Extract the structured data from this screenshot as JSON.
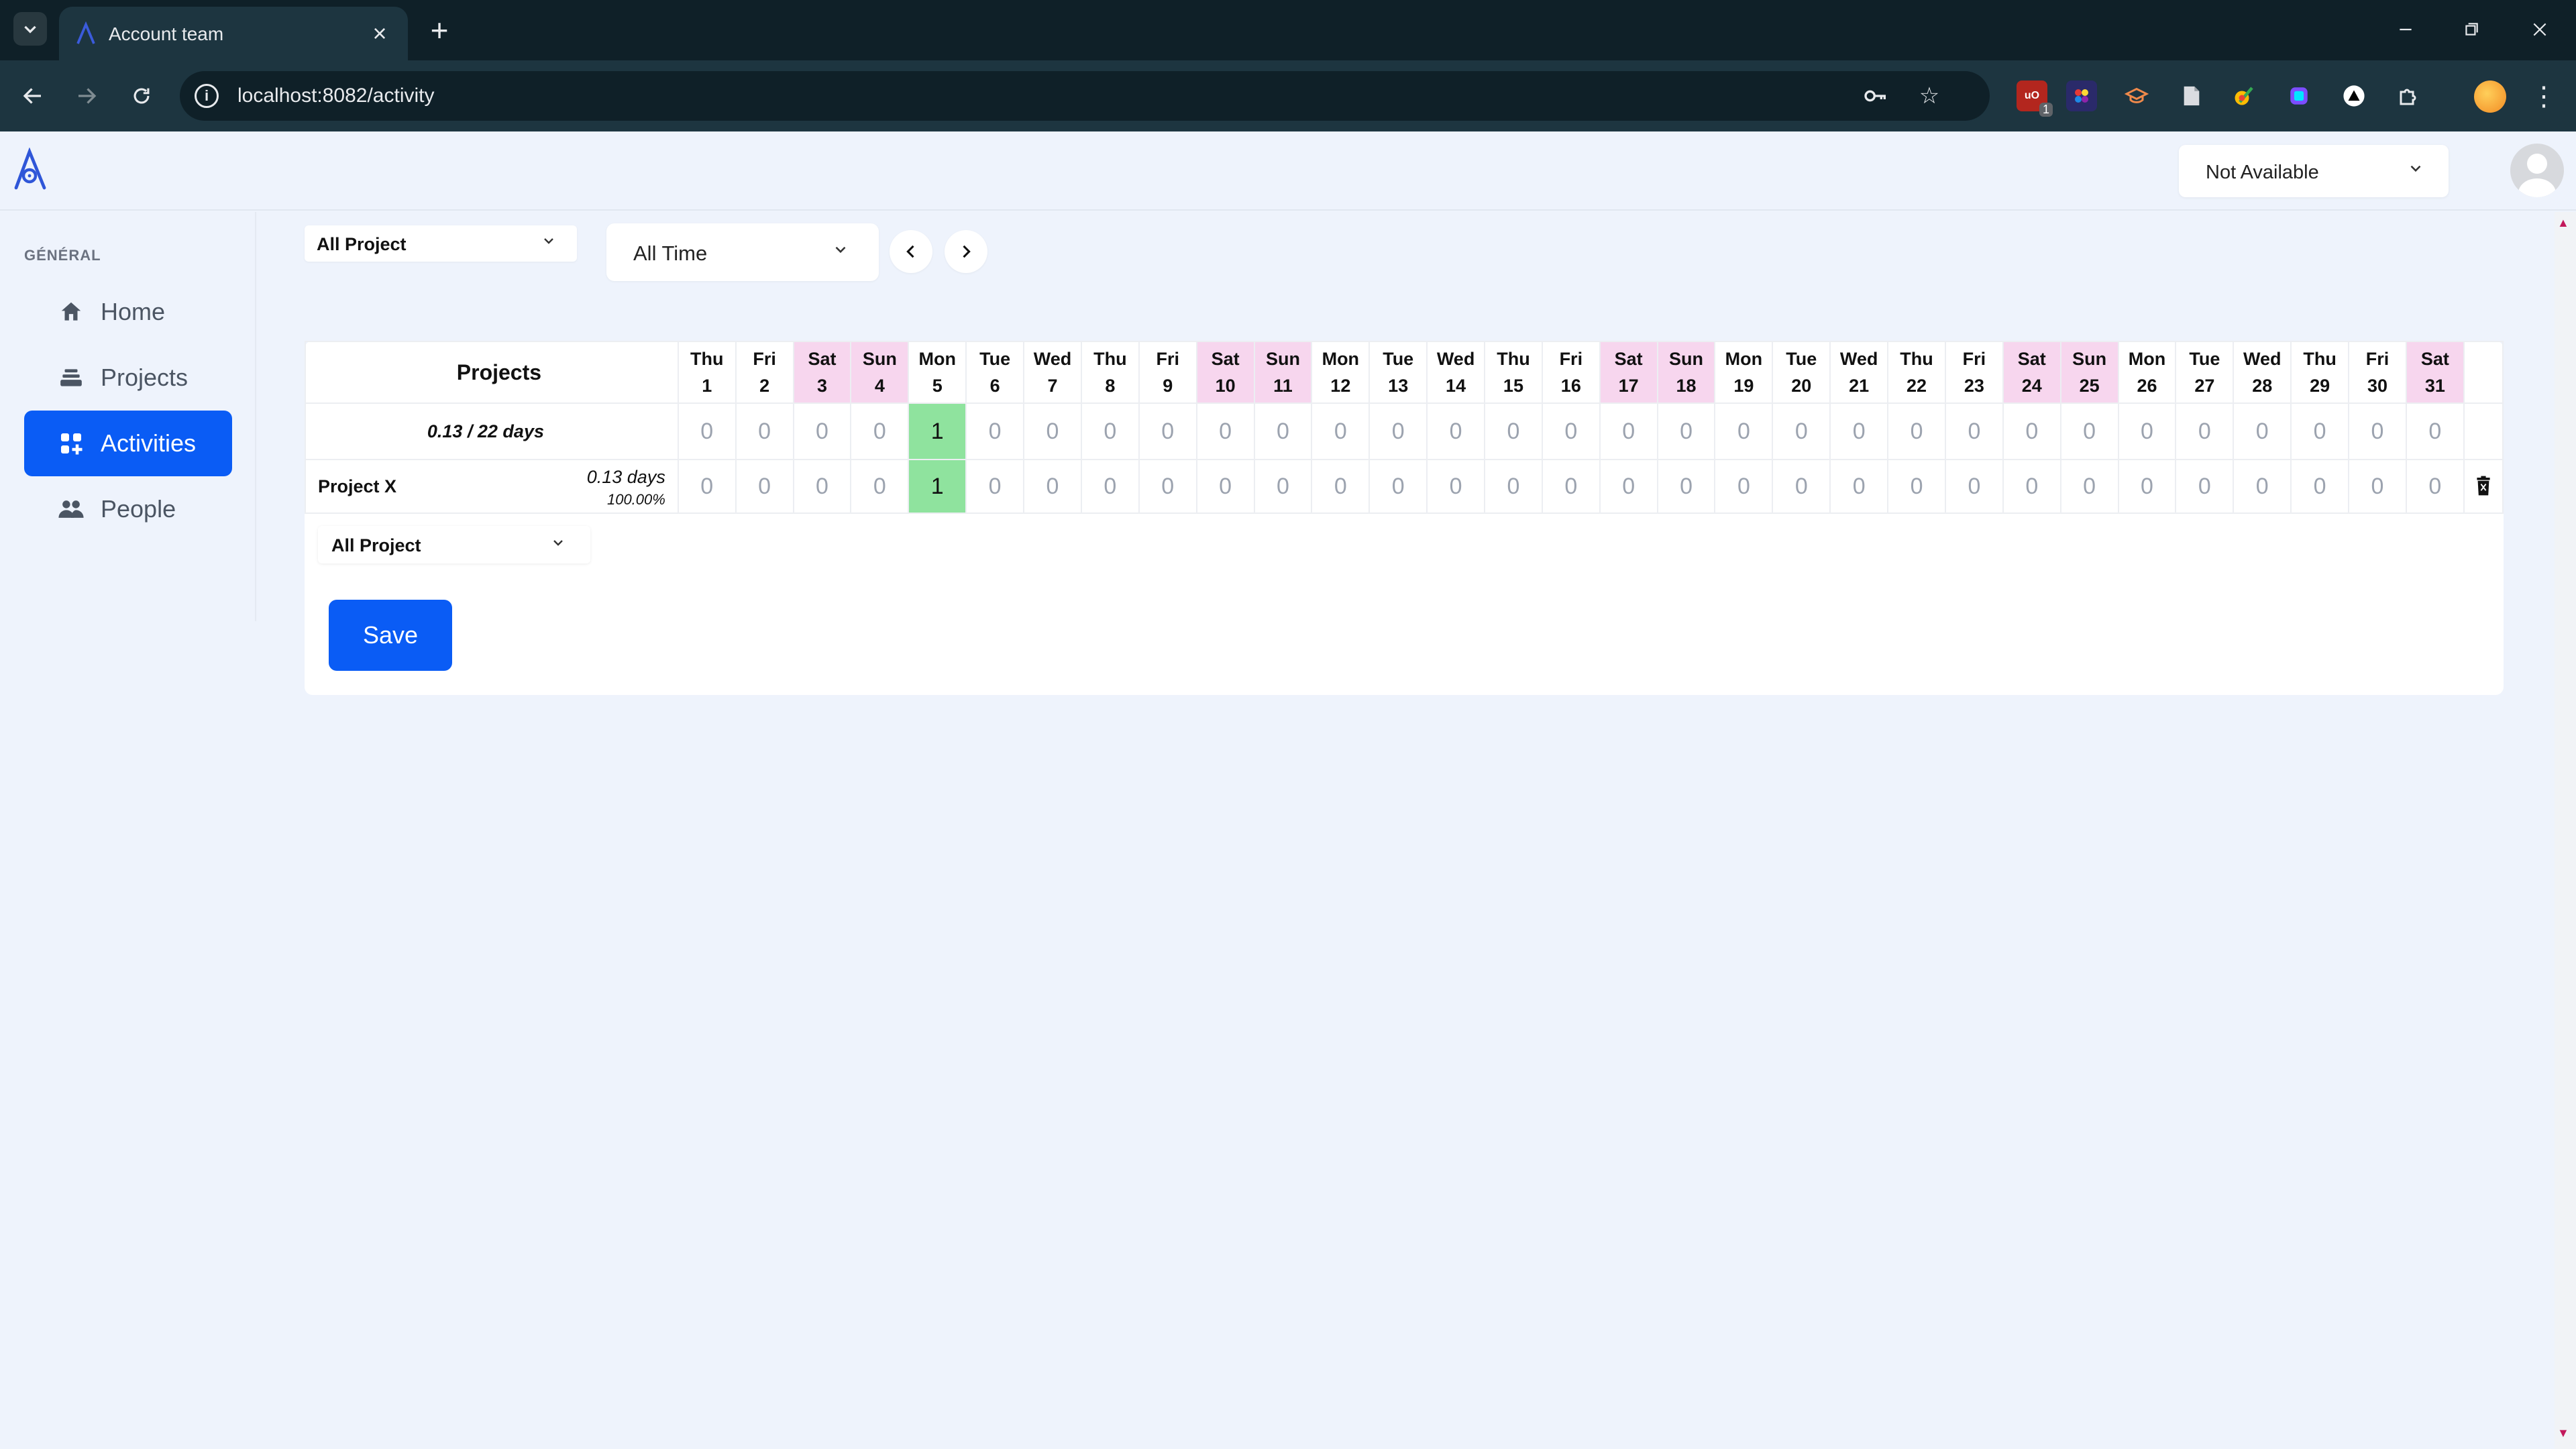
{
  "browser": {
    "tab_title": "Account team",
    "url": "localhost:8082/activity",
    "extension_badge": "1"
  },
  "header": {
    "status_select": "Not Available"
  },
  "sidebar": {
    "section_label": "GÉNÉRAL",
    "items": [
      {
        "label": "Home",
        "icon": "home-icon"
      },
      {
        "label": "Projects",
        "icon": "layers-icon"
      },
      {
        "label": "Activities",
        "icon": "grid-icon",
        "active": true
      },
      {
        "label": "People",
        "icon": "people-icon"
      }
    ]
  },
  "filters": {
    "project": "All Project",
    "period": "All Time"
  },
  "table": {
    "header_label": "Projects",
    "days": [
      {
        "dow": "Thu",
        "num": "1",
        "weekend": false
      },
      {
        "dow": "Fri",
        "num": "2",
        "weekend": false
      },
      {
        "dow": "Sat",
        "num": "3",
        "weekend": true
      },
      {
        "dow": "Sun",
        "num": "4",
        "weekend": true
      },
      {
        "dow": "Mon",
        "num": "5",
        "weekend": false
      },
      {
        "dow": "Tue",
        "num": "6",
        "weekend": false
      },
      {
        "dow": "Wed",
        "num": "7",
        "weekend": false
      },
      {
        "dow": "Thu",
        "num": "8",
        "weekend": false
      },
      {
        "dow": "Fri",
        "num": "9",
        "weekend": false
      },
      {
        "dow": "Sat",
        "num": "10",
        "weekend": true
      },
      {
        "dow": "Sun",
        "num": "11",
        "weekend": true
      },
      {
        "dow": "Mon",
        "num": "12",
        "weekend": false
      },
      {
        "dow": "Tue",
        "num": "13",
        "weekend": false
      },
      {
        "dow": "Wed",
        "num": "14",
        "weekend": false
      },
      {
        "dow": "Thu",
        "num": "15",
        "weekend": false
      },
      {
        "dow": "Fri",
        "num": "16",
        "weekend": false
      },
      {
        "dow": "Sat",
        "num": "17",
        "weekend": true
      },
      {
        "dow": "Sun",
        "num": "18",
        "weekend": true
      },
      {
        "dow": "Mon",
        "num": "19",
        "weekend": false
      },
      {
        "dow": "Tue",
        "num": "20",
        "weekend": false
      },
      {
        "dow": "Wed",
        "num": "21",
        "weekend": false
      },
      {
        "dow": "Thu",
        "num": "22",
        "weekend": false
      },
      {
        "dow": "Fri",
        "num": "23",
        "weekend": false
      },
      {
        "dow": "Sat",
        "num": "24",
        "weekend": true
      },
      {
        "dow": "Sun",
        "num": "25",
        "weekend": true
      },
      {
        "dow": "Mon",
        "num": "26",
        "weekend": false
      },
      {
        "dow": "Tue",
        "num": "27",
        "weekend": false
      },
      {
        "dow": "Wed",
        "num": "28",
        "weekend": false
      },
      {
        "dow": "Thu",
        "num": "29",
        "weekend": false
      },
      {
        "dow": "Fri",
        "num": "30",
        "weekend": false
      },
      {
        "dow": "Sat",
        "num": "31",
        "weekend": true
      }
    ],
    "summary": {
      "label": "0.13 / 22 days",
      "values": [
        "0",
        "0",
        "0",
        "0",
        "1",
        "0",
        "0",
        "0",
        "0",
        "0",
        "0",
        "0",
        "0",
        "0",
        "0",
        "0",
        "0",
        "0",
        "0",
        "0",
        "0",
        "0",
        "0",
        "0",
        "0",
        "0",
        "0",
        "0",
        "0",
        "0",
        "0"
      ]
    },
    "rows": [
      {
        "name": "Project X",
        "days": "0.13 days",
        "percent": "100.00%",
        "values": [
          "0",
          "0",
          "0",
          "0",
          "1",
          "0",
          "0",
          "0",
          "0",
          "0",
          "0",
          "0",
          "0",
          "0",
          "0",
          "0",
          "0",
          "0",
          "0",
          "0",
          "0",
          "0",
          "0",
          "0",
          "0",
          "0",
          "0",
          "0",
          "0",
          "0",
          "0"
        ]
      }
    ]
  },
  "add_project_select": "All Project",
  "save_label": "Save",
  "colors": {
    "primary": "#0a5cf5",
    "weekend": "#f7d6ee",
    "filled_cell": "#8fe39e",
    "background": "#eef3fc"
  }
}
